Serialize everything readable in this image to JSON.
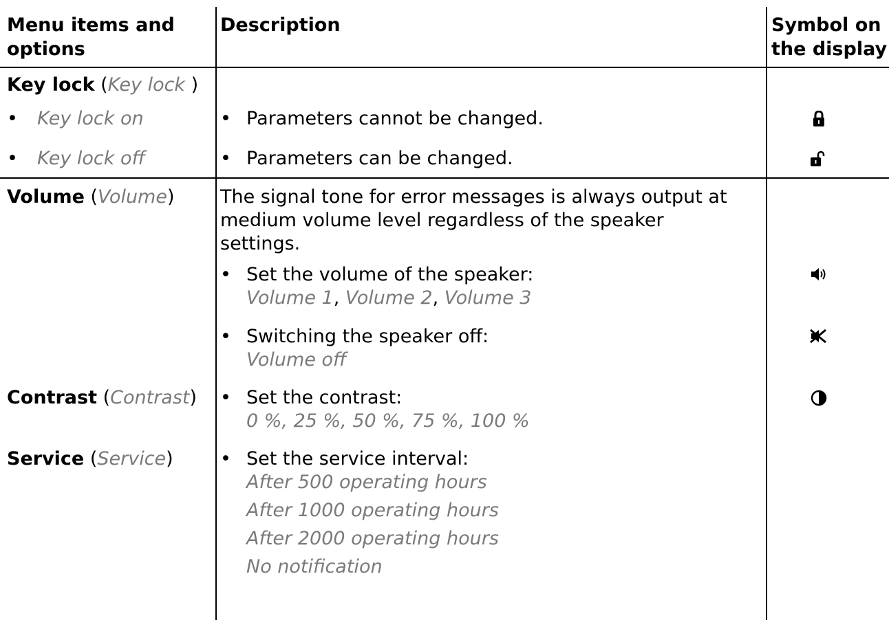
{
  "header": {
    "col1_line1": "Menu items and",
    "col1_line2": "options",
    "col2": "Description",
    "col3_line1": "Symbol on",
    "col3_line2": "the display"
  },
  "keylock": {
    "title": "Key lock",
    "title_option": "Key lock ",
    "on_label": "Key lock on",
    "on_desc": "Parameters cannot be changed.",
    "on_icon": "lock-closed-icon",
    "off_label": "Key lock off",
    "off_desc": "Parameters can be changed.",
    "off_icon": "lock-open-icon"
  },
  "volume": {
    "title": "Volume",
    "title_option": "Volume",
    "desc_line1": "The signal tone for error messages is always output at",
    "desc_line2": "medium volume level regardless of the speaker",
    "desc_line3": "settings.",
    "set_label": "Set the volume of the speaker:",
    "opt1": "Volume 1",
    "opt2": "Volume 2",
    "opt3": "Volume 3",
    "sep": ", ",
    "set_icon": "speaker-icon",
    "off_label": "Switching the speaker off:",
    "off_option": "Volume off",
    "off_icon": "speaker-muted-icon"
  },
  "contrast": {
    "title": "Contrast",
    "title_option": "Contrast",
    "set_label": "Set the contrast:",
    "options": "0 %, 25 %, 50 %, 75 %, 100 %",
    "icon": "contrast-icon"
  },
  "service": {
    "title": "Service",
    "title_option": "Service",
    "set_label": "Set the service interval:",
    "opt1": "After 500 operating hours",
    "opt2": "After 1000 operating hours",
    "opt3": "After 2000 operating hours",
    "opt4": "No notification"
  },
  "punct": {
    "open": " (",
    "close": ")",
    "bullet": "•"
  }
}
